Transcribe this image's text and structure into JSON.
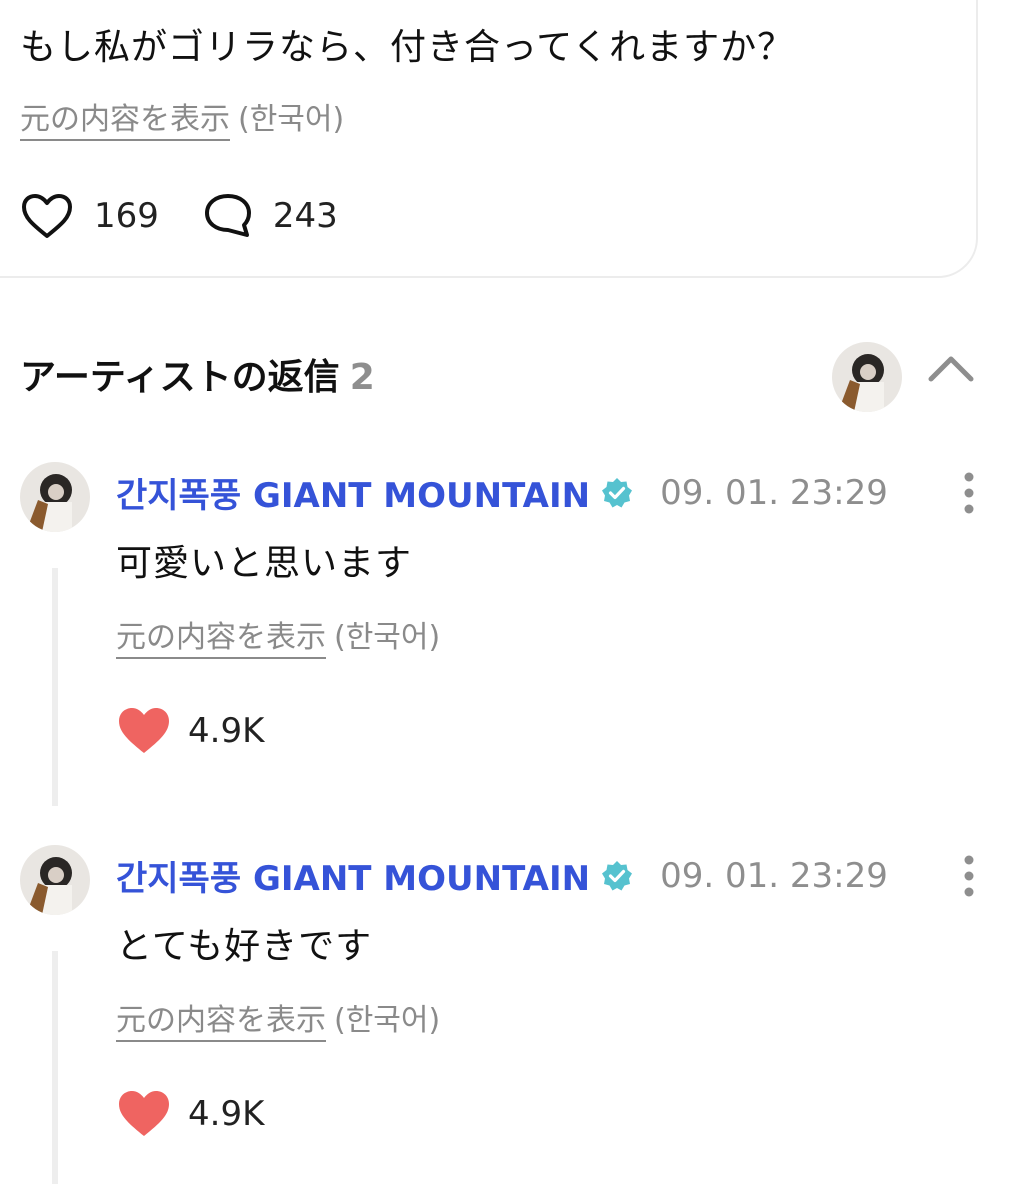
{
  "post": {
    "text": "もし私がゴリラなら、付き合ってくれますか？",
    "translate_link": "元の内容を表示",
    "translate_lang": "(한국어)",
    "likes": "169",
    "comments": "243"
  },
  "replies_section": {
    "title": "アーティストの返信",
    "count": "2"
  },
  "replies": [
    {
      "author": "간지폭풍 GIANT MOUNTAIN",
      "time": "09. 01. 23:29",
      "text": "可愛いと思います",
      "translate_link": "元の内容を表示",
      "translate_lang": "(한국어)",
      "likes": "4.9K"
    },
    {
      "author": "간지폭풍 GIANT MOUNTAIN",
      "time": "09. 01. 23:29",
      "text": "とても好きです",
      "translate_link": "元の内容を表示",
      "translate_lang": "(한국어)",
      "likes": "4.9K"
    }
  ],
  "colors": {
    "author": "#3553d8",
    "verified": "#56c2cf",
    "liked_heart": "#ef6461",
    "muted_text": "#8e8e8e"
  },
  "icons": {
    "like": "heart-outline-icon",
    "comment": "speech-bubble-icon",
    "collapse": "chevron-up-icon",
    "verified": "verified-badge-icon",
    "more": "more-vertical-icon",
    "liked": "heart-filled-icon"
  }
}
